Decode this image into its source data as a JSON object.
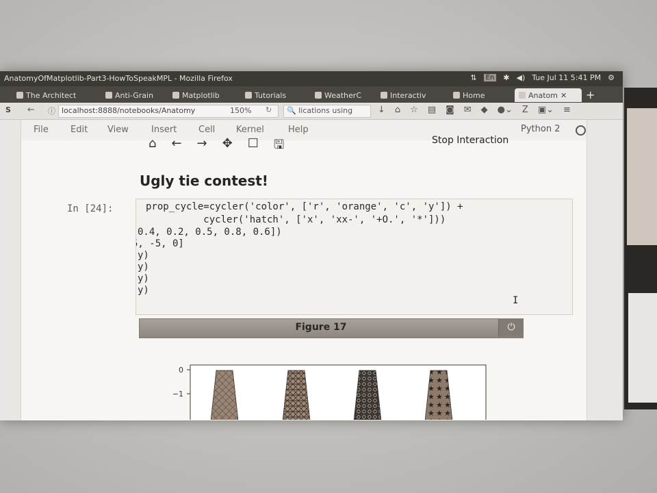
{
  "os": {
    "window_title": "AnatomyOfMatplotlib-Part3-HowToSpeakMPL - Mozilla Firefox",
    "lang": "En",
    "clock": "Tue Jul 11  5:41 PM"
  },
  "tabs": [
    {
      "label": "The Architect"
    },
    {
      "label": "Anti-Grain"
    },
    {
      "label": "Matplotlib"
    },
    {
      "label": "Tutorials"
    },
    {
      "label": "WeatherC"
    },
    {
      "label": "Interactiv"
    },
    {
      "label": "Home"
    },
    {
      "label": "Anatom"
    }
  ],
  "nav": {
    "url": "localhost:8888/notebooks/Anatomy",
    "zoom": "150%",
    "search": "lications using"
  },
  "menu": {
    "items": [
      "File",
      "Edit",
      "View",
      "Insert",
      "Cell",
      "Kernel",
      "Help"
    ],
    "kernel": "Python 2"
  },
  "toolbar": {
    "stop_label": "Stop Interaction"
  },
  "notebook": {
    "heading": "Ugly tie contest!",
    "prompt": "In [24]:",
    "code_lines": [
      "prop_cycle=cycler('color', ['r', 'orange', 'c', 'y']) +",
      "          cycler('hatch', ['x', 'xx-', '+O.', '*']))",
      "0.4, 0.2, 0.5, 0.8, 0.6])",
      "5, -5, 0]",
      "y)",
      "y)",
      "y)",
      "y)"
    ]
  },
  "figure": {
    "title": "Figure 17",
    "power_icon": "power-icon"
  },
  "chart_data": {
    "type": "bar",
    "title": "",
    "xlabel": "",
    "ylabel": "",
    "y_tick_labels": [
      "0",
      "−1"
    ],
    "series": [
      {
        "hatch": "x"
      },
      {
        "hatch": "xx-"
      },
      {
        "hatch": "+O."
      },
      {
        "hatch": "*"
      }
    ]
  }
}
